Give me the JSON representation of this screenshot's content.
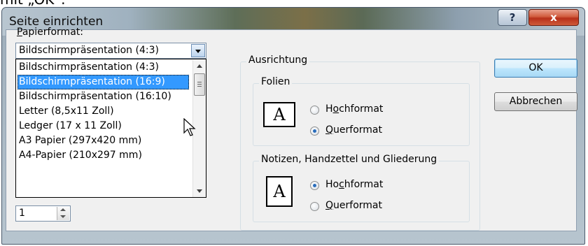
{
  "caption_fragment": "mit „OK“.",
  "window": {
    "title": "Seite einrichten",
    "help_label": "?",
    "close_label": "x"
  },
  "papierformat": {
    "label_prefix": "P",
    "label_rest": "apierformat:",
    "selected": "Bildschirmpräsentation (4:3)",
    "options": [
      {
        "text": "Bildschirmpräsentation (4:3)",
        "selected": false
      },
      {
        "text": "Bildschirmpräsentation (16:9)",
        "selected": true
      },
      {
        "text": "Bildschirmpräsentation (16:10)",
        "selected": false
      },
      {
        "text": "Letter (8,5x11 Zoll)",
        "selected": false
      },
      {
        "text": "Ledger (17 x 11 Zoll)",
        "selected": false
      },
      {
        "text": "A3 Papier (297x420 mm)",
        "selected": false
      },
      {
        "text": "A4-Papier (210x297 mm)",
        "selected": false
      }
    ]
  },
  "numbering": {
    "value": "1"
  },
  "ausrichtung": {
    "title": "Ausrichtung",
    "folien": {
      "title": "Folien",
      "icon_letter": "A",
      "hochformat_pre": "H",
      "hochformat_key": "o",
      "hochformat_post": "chformat",
      "querformat_key": "Q",
      "querformat_post": "uerformat",
      "selected": "Querformat"
    },
    "notizen": {
      "title": "Notizen, Handzettel und Gliederung",
      "icon_letter": "A",
      "hochformat_pre": "Ho",
      "hochformat_key": "c",
      "hochformat_post": "hformat",
      "querformat_key": "Q",
      "querformat_post": "uerformat",
      "selected": "Hochformat"
    }
  },
  "buttons": {
    "ok": "OK",
    "cancel": "Abbrechen"
  }
}
